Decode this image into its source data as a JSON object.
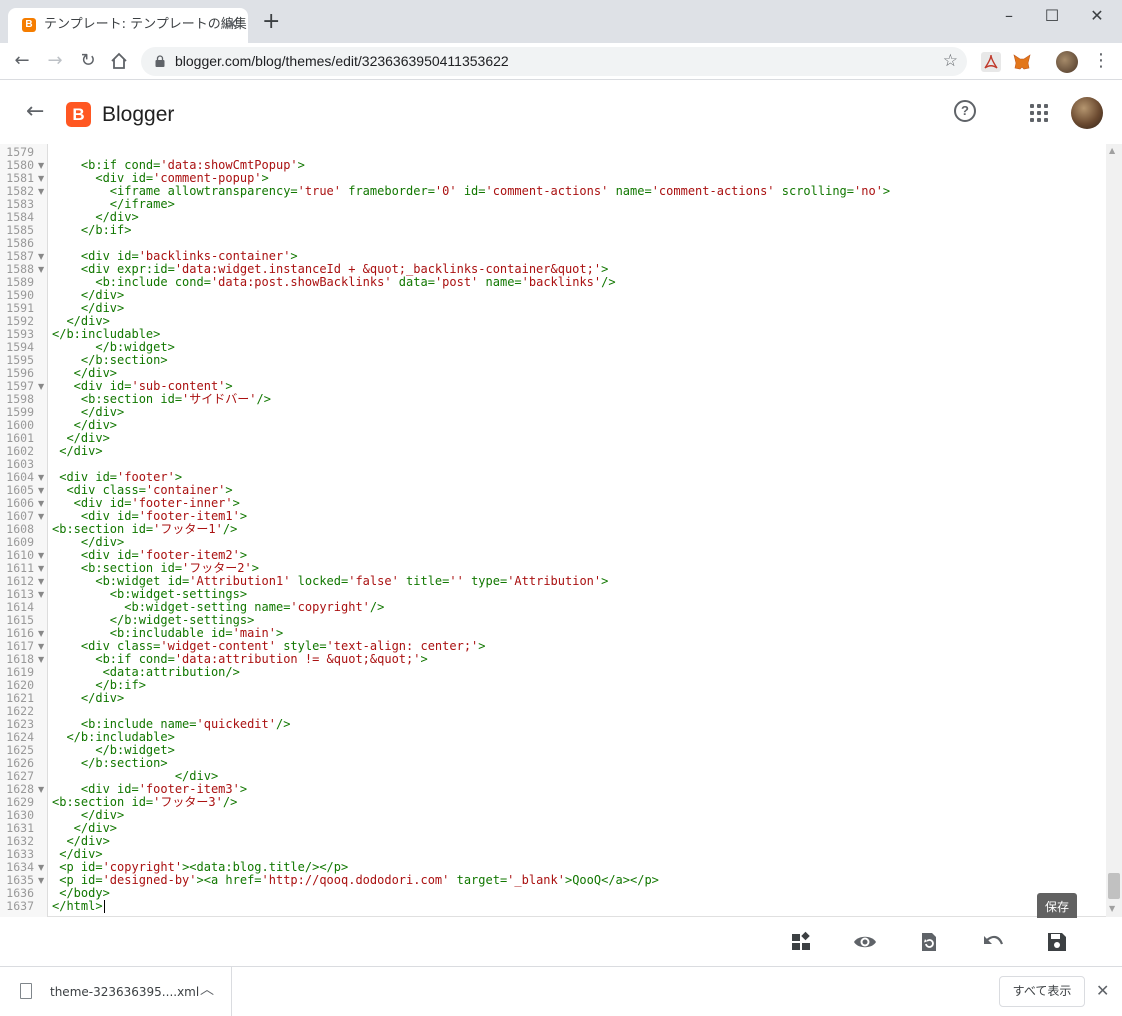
{
  "browser": {
    "tab_title": "テンプレート: テンプレートの編集",
    "tab_favicon_letter": "B",
    "url": "blogger.com/blog/themes/edit/3236363950411353622",
    "icons": [
      "back-icon",
      "forward-icon",
      "reload-icon",
      "home-icon",
      "lock-icon",
      "star-icon",
      "pdf-extension-icon",
      "metamask-extension-icon",
      "profile-avatar",
      "chrome-menu-icon"
    ]
  },
  "blogger": {
    "logo_letter": "B",
    "brand_name": "Blogger",
    "brand_color": "#ff5722"
  },
  "editor": {
    "lines": [
      {
        "n": "1579",
        "fold": false,
        "code": ""
      },
      {
        "n": "1580",
        "fold": true,
        "code": "    <b:if cond='data:showCmtPopup'>"
      },
      {
        "n": "1581",
        "fold": true,
        "code": "      <div id='comment-popup'>"
      },
      {
        "n": "1582",
        "fold": true,
        "code": "        <iframe allowtransparency='true' frameborder='0' id='comment-actions' name='comment-actions' scrolling='no'>"
      },
      {
        "n": "1583",
        "fold": false,
        "code": "        </iframe>"
      },
      {
        "n": "1584",
        "fold": false,
        "code": "      </div>"
      },
      {
        "n": "1585",
        "fold": false,
        "code": "    </b:if>"
      },
      {
        "n": "1586",
        "fold": false,
        "code": ""
      },
      {
        "n": "1587",
        "fold": true,
        "code": "    <div id='backlinks-container'>"
      },
      {
        "n": "1588",
        "fold": true,
        "code": "    <div expr:id='data:widget.instanceId + &quot;_backlinks-container&quot;'>"
      },
      {
        "n": "1589",
        "fold": false,
        "code": "      <b:include cond='data:post.showBacklinks' data='post' name='backlinks'/>"
      },
      {
        "n": "1590",
        "fold": false,
        "code": "    </div>"
      },
      {
        "n": "1591",
        "fold": false,
        "code": "    </div>"
      },
      {
        "n": "1592",
        "fold": false,
        "code": "  </div>"
      },
      {
        "n": "1593",
        "fold": false,
        "code": "</b:includable>"
      },
      {
        "n": "1594",
        "fold": false,
        "code": "      </b:widget>"
      },
      {
        "n": "1595",
        "fold": false,
        "code": "    </b:section>"
      },
      {
        "n": "1596",
        "fold": false,
        "code": "   </div>"
      },
      {
        "n": "1597",
        "fold": true,
        "code": "   <div id='sub-content'>"
      },
      {
        "n": "1598",
        "fold": false,
        "code": "    <b:section id='サイドバー'/>"
      },
      {
        "n": "1599",
        "fold": false,
        "code": "    </div>"
      },
      {
        "n": "1600",
        "fold": false,
        "code": "   </div>"
      },
      {
        "n": "1601",
        "fold": false,
        "code": "  </div>"
      },
      {
        "n": "1602",
        "fold": false,
        "code": " </div>"
      },
      {
        "n": "1603",
        "fold": false,
        "code": ""
      },
      {
        "n": "1604",
        "fold": true,
        "code": " <div id='footer'>"
      },
      {
        "n": "1605",
        "fold": true,
        "code": "  <div class='container'>"
      },
      {
        "n": "1606",
        "fold": true,
        "code": "   <div id='footer-inner'>"
      },
      {
        "n": "1607",
        "fold": true,
        "code": "    <div id='footer-item1'>"
      },
      {
        "n": "1608",
        "fold": false,
        "code": "<b:section id='フッター1'/>"
      },
      {
        "n": "1609",
        "fold": false,
        "code": "    </div>"
      },
      {
        "n": "1610",
        "fold": true,
        "code": "    <div id='footer-item2'>"
      },
      {
        "n": "1611",
        "fold": true,
        "code": "    <b:section id='フッター2'>"
      },
      {
        "n": "1612",
        "fold": true,
        "code": "      <b:widget id='Attribution1' locked='false' title='' type='Attribution'>"
      },
      {
        "n": "1613",
        "fold": true,
        "code": "        <b:widget-settings>"
      },
      {
        "n": "1614",
        "fold": false,
        "code": "          <b:widget-setting name='copyright'/>"
      },
      {
        "n": "1615",
        "fold": false,
        "code": "        </b:widget-settings>"
      },
      {
        "n": "1616",
        "fold": true,
        "code": "        <b:includable id='main'>"
      },
      {
        "n": "1617",
        "fold": true,
        "code": "    <div class='widget-content' style='text-align: center;'>"
      },
      {
        "n": "1618",
        "fold": true,
        "code": "      <b:if cond='data:attribution != &quot;&quot;'>"
      },
      {
        "n": "1619",
        "fold": false,
        "code": "       <data:attribution/>"
      },
      {
        "n": "1620",
        "fold": false,
        "code": "      </b:if>"
      },
      {
        "n": "1621",
        "fold": false,
        "code": "    </div>"
      },
      {
        "n": "1622",
        "fold": false,
        "code": ""
      },
      {
        "n": "1623",
        "fold": false,
        "code": "    <b:include name='quickedit'/>"
      },
      {
        "n": "1624",
        "fold": false,
        "code": "  </b:includable>"
      },
      {
        "n": "1625",
        "fold": false,
        "code": "      </b:widget>"
      },
      {
        "n": "1626",
        "fold": false,
        "code": "    </b:section>"
      },
      {
        "n": "1627",
        "fold": false,
        "code": "                 </div>"
      },
      {
        "n": "1628",
        "fold": true,
        "code": "    <div id='footer-item3'>"
      },
      {
        "n": "1629",
        "fold": false,
        "code": "<b:section id='フッター3'/>"
      },
      {
        "n": "1630",
        "fold": false,
        "code": "    </div>"
      },
      {
        "n": "1631",
        "fold": false,
        "code": "   </div>"
      },
      {
        "n": "1632",
        "fold": false,
        "code": "  </div>"
      },
      {
        "n": "1633",
        "fold": false,
        "code": " </div>"
      },
      {
        "n": "1634",
        "fold": true,
        "code": " <p id='copyright'><data:blog.title/></p>"
      },
      {
        "n": "1635",
        "fold": true,
        "code": " <p id='designed-by'><a href='http://qooq.dododori.com' target='_blank'>QooQ</a></p>"
      },
      {
        "n": "1636",
        "fold": false,
        "code": " </body>"
      },
      {
        "n": "1637",
        "fold": false,
        "code": "</html>"
      }
    ]
  },
  "actions": {
    "tooltip": "保存",
    "buttons": [
      "widgets-icon",
      "preview-icon",
      "revert-icon",
      "undo-icon",
      "save-icon"
    ]
  },
  "downloads": {
    "file_name": "theme-323636395....xml",
    "show_all_label": "すべて表示"
  }
}
